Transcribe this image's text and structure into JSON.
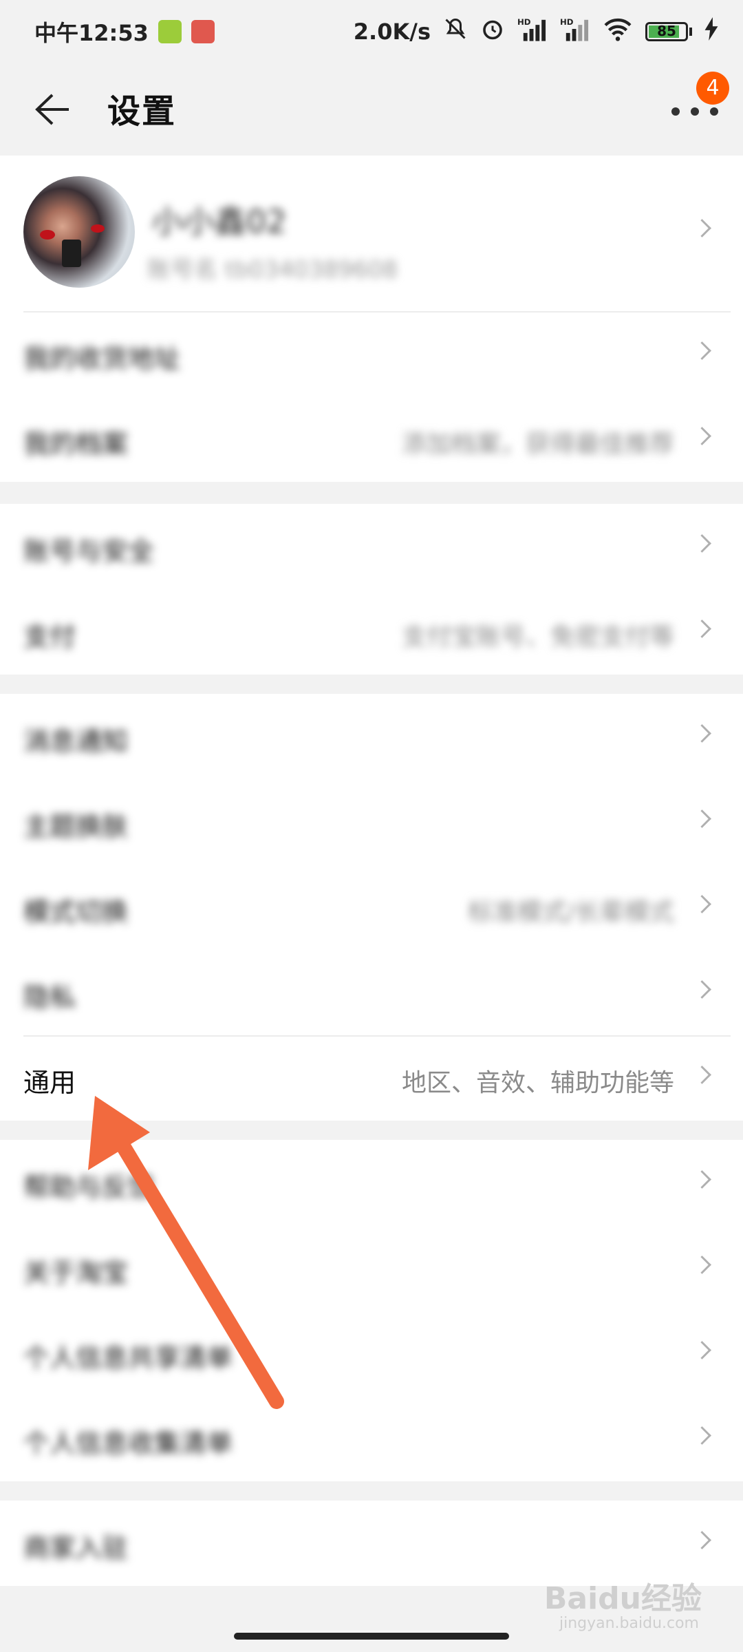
{
  "status_bar": {
    "time": "中午12:53",
    "net_speed": "2.0K/s",
    "signal1": "HD",
    "signal2": "HD",
    "battery_level": "85",
    "battery_fraction": 0.85
  },
  "header": {
    "title": "设置",
    "more_badge": "4"
  },
  "profile": {
    "name": "小小鑫02",
    "account": "账号名 tb0340389608"
  },
  "groups": [
    {
      "items": [
        {
          "label": "我的收货地址",
          "value": ""
        },
        {
          "label": "我的档案",
          "value": "添加档案，获得最佳推荐"
        }
      ]
    },
    {
      "items": [
        {
          "label": "账号与安全",
          "value": ""
        },
        {
          "label": "支付",
          "value": "支付宝账号、免密支付等"
        }
      ]
    },
    {
      "items": [
        {
          "label": "消息通知",
          "value": ""
        },
        {
          "label": "主题换肤",
          "value": ""
        },
        {
          "label": "模式切换",
          "value": "标准模式/长辈模式"
        },
        {
          "label": "隐私",
          "value": ""
        },
        {
          "label": "通用",
          "value": "地区、音效、辅助功能等"
        }
      ]
    },
    {
      "items": [
        {
          "label": "帮助与反馈",
          "value": ""
        },
        {
          "label": "关于淘宝",
          "value": ""
        },
        {
          "label": "个人信息共享清单",
          "value": ""
        },
        {
          "label": "个人信息收集清单",
          "value": ""
        }
      ]
    },
    {
      "items": [
        {
          "label": "商家入驻",
          "value": ""
        }
      ]
    }
  ],
  "watermark": {
    "brand": "Baidu经验",
    "url": "jingyan.baidu.com"
  },
  "colors": {
    "accent": "#ff5a00",
    "arrow": "#f26a3e"
  }
}
